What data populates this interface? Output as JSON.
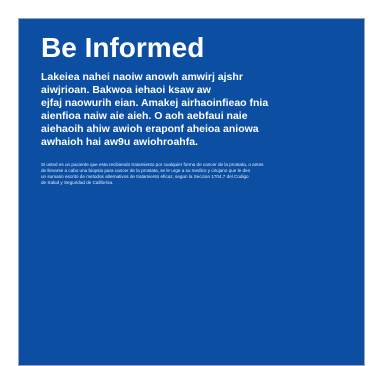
{
  "document": {
    "title": "Be Informed",
    "lead_lines": [
      "Lakeiea nahei naoiw anowh amwirj ajshr",
      "aiwjrioan. Bakwoa iehaoi ksaw aw",
      "ejfaj naowurih eian. Amakej airhaoinfieao fnia",
      "aienfioa naiw aie aieh. O aoh aebfaui naie",
      "aiehaoih ahiw awioh eraponf aheioa aniowa",
      "awhaioh hai aw9u awiohroahfa."
    ],
    "fine_print_lines": [
      "Si usted es un paciente que esta recibiendo tratamiento por cualquier forma de cancer de la prostata, o antes",
      "de llevarse a cabo una biopsia para cancer de la prostata, se le urge a su medico y cirujano que le den",
      "un sumario escrito de metodos alternativos de tratamiento eficaz, segun la Seccion 1704.7 del Codigo",
      "de Salud y Seguridad de California."
    ]
  },
  "colors": {
    "panel_background": "#0b4ea2",
    "text": "#ffffff"
  }
}
